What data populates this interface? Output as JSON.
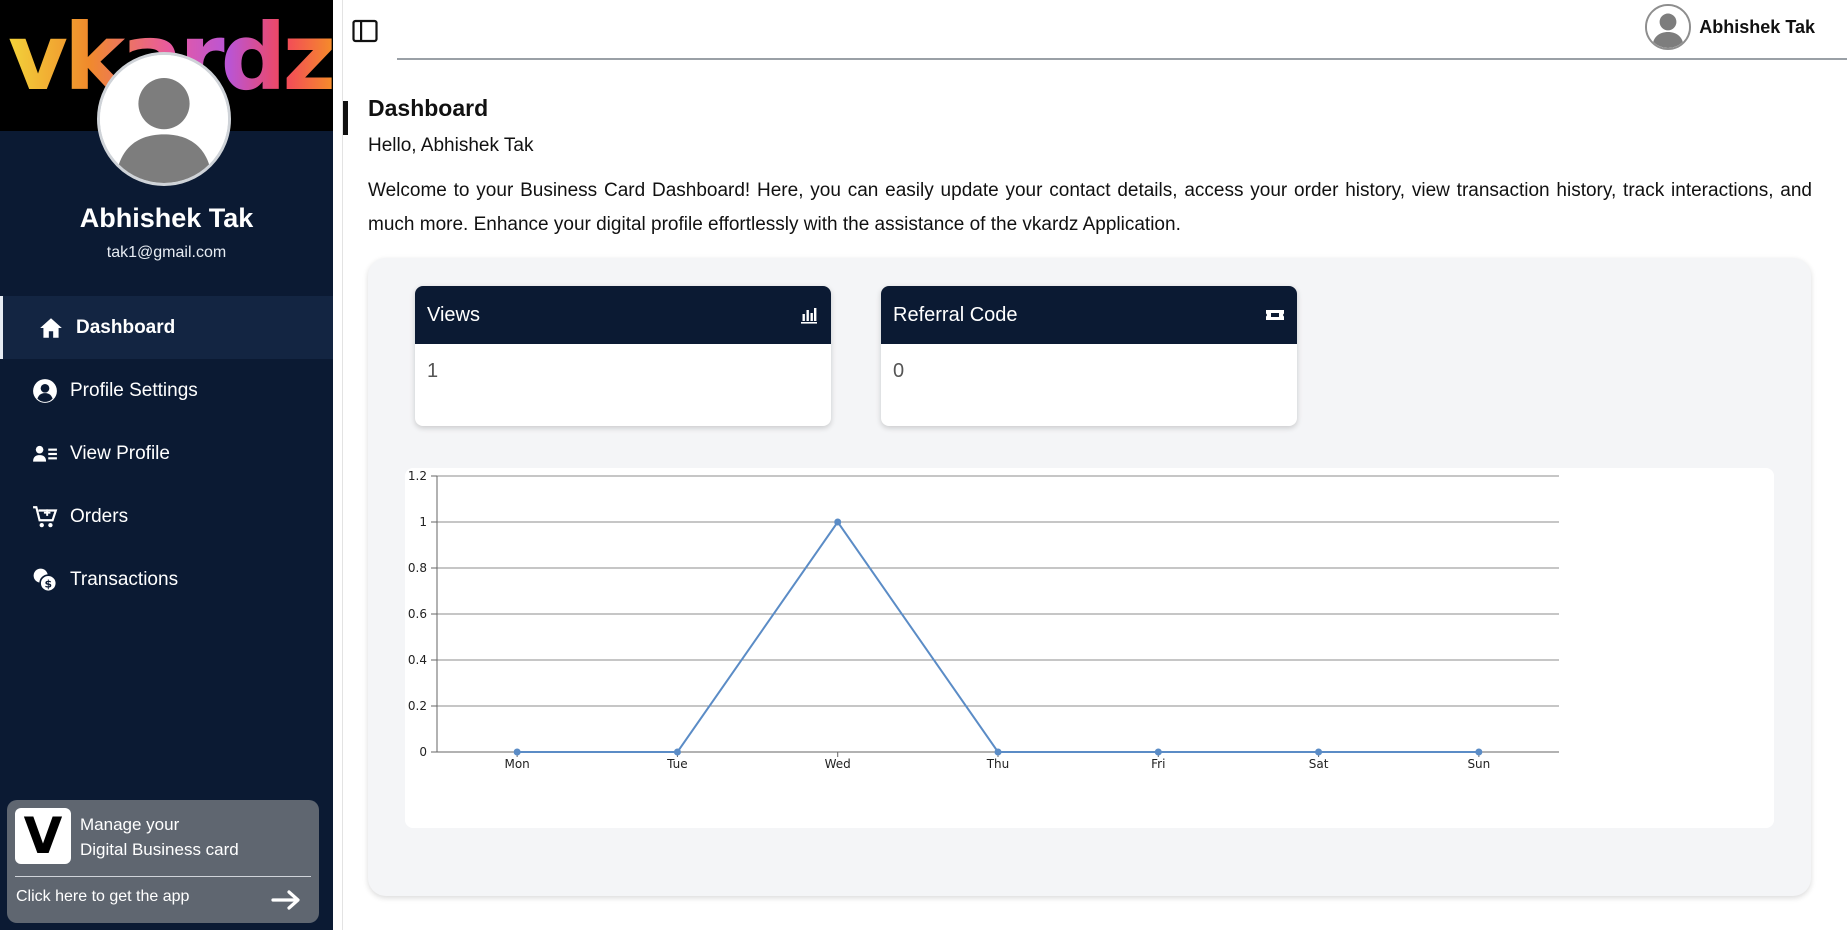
{
  "brand": {
    "logo_text": "vkardz"
  },
  "user": {
    "name": "Abhishek Tak",
    "email": "tak1@gmail.com"
  },
  "sidebar": {
    "items": [
      {
        "label": "Dashboard",
        "icon": "home-icon",
        "active": true
      },
      {
        "label": "Profile Settings",
        "icon": "user-circle-icon",
        "active": false
      },
      {
        "label": "View Profile",
        "icon": "user-list-icon",
        "active": false
      },
      {
        "label": "Orders",
        "icon": "cart-icon",
        "active": false
      },
      {
        "label": "Transactions",
        "icon": "coins-icon",
        "active": false
      }
    ],
    "promo": {
      "logo_letter": "V",
      "line1": "Manage your",
      "line2": "Digital Business card",
      "cta": "Click here to get the app"
    }
  },
  "header": {
    "user_name": "Abhishek Tak"
  },
  "main": {
    "title": "Dashboard",
    "greeting": "Hello, Abhishek Tak",
    "welcome": "Welcome to your Business Card Dashboard! Here, you can easily update your contact details, access your order history, view transaction history, track interactions, and much more. Enhance your digital profile effortlessly with the assistance of the vkardz Application.",
    "cards": [
      {
        "title": "Views",
        "value": "1",
        "icon": "bar-chart-icon"
      },
      {
        "title": "Referral Code",
        "value": "0",
        "icon": "ticket-icon"
      }
    ]
  },
  "colors": {
    "sidebar_bg": "#0b1a33",
    "line": "#5b8cc6",
    "panel_bg": "#f4f5f7"
  },
  "chart_data": {
    "type": "line",
    "categories": [
      "Mon",
      "Tue",
      "Wed",
      "Thu",
      "Fri",
      "Sat",
      "Sun"
    ],
    "series": [
      {
        "values": [
          0,
          0,
          1,
          0,
          0,
          0,
          0
        ]
      }
    ],
    "ylim": [
      0,
      1.2
    ],
    "yticks": [
      "0",
      "0.2",
      "0.4",
      "0.6",
      "0.8",
      "1",
      "1.2"
    ],
    "grid": true,
    "legend": "none"
  }
}
